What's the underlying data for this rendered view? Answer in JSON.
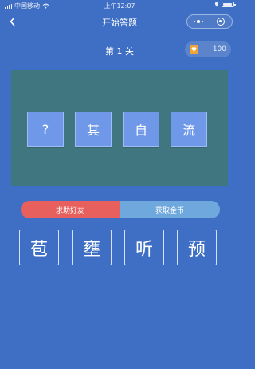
{
  "status_bar": {
    "carrier": "中国移动",
    "time": "上午12:07",
    "battery_level": 0.9
  },
  "nav": {
    "title": "开始答题",
    "back_icon": "chevron-left-icon",
    "menu_icon": "more-dots-icon",
    "close_icon": "target-circle-icon"
  },
  "level": {
    "label": "第 1 关"
  },
  "coins": {
    "icon": "coin-heart-icon",
    "amount": "100"
  },
  "puzzle": {
    "slots": [
      "?",
      "其",
      "自",
      "流"
    ]
  },
  "actions": {
    "help_label": "求助好友",
    "get_coins_label": "获取金币"
  },
  "choices": [
    "苞",
    "壅",
    "听",
    "预"
  ],
  "colors": {
    "background": "#3f6fc4",
    "board": "#3f7680",
    "tile": "#6f98e8",
    "help": "#e8605d",
    "get_coins": "#6fa8dc",
    "coin": "#f0a53a"
  }
}
